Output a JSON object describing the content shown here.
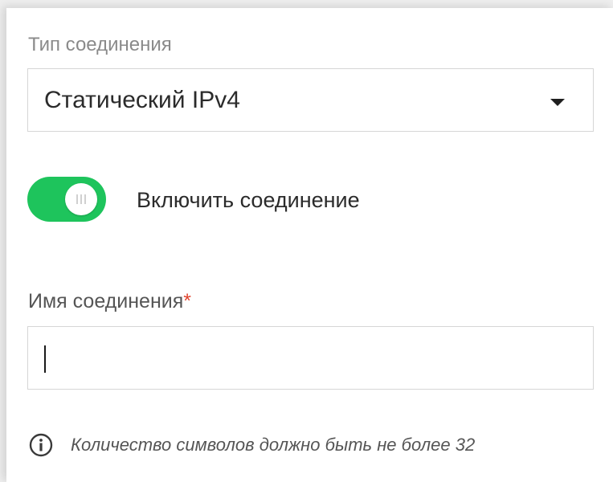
{
  "connection_type": {
    "label": "Тип соединения",
    "selected": "Статический IPv4",
    "icon": "caret-down-icon"
  },
  "enable_toggle": {
    "label": "Включить соединение",
    "on": true,
    "color": "#1ec45c"
  },
  "connection_name": {
    "label": "Имя соединения",
    "required_mark": "*",
    "value": "",
    "required_color": "#e0452f"
  },
  "hint": {
    "icon": "info-icon",
    "text": "Количество символов должно быть не более 32"
  }
}
